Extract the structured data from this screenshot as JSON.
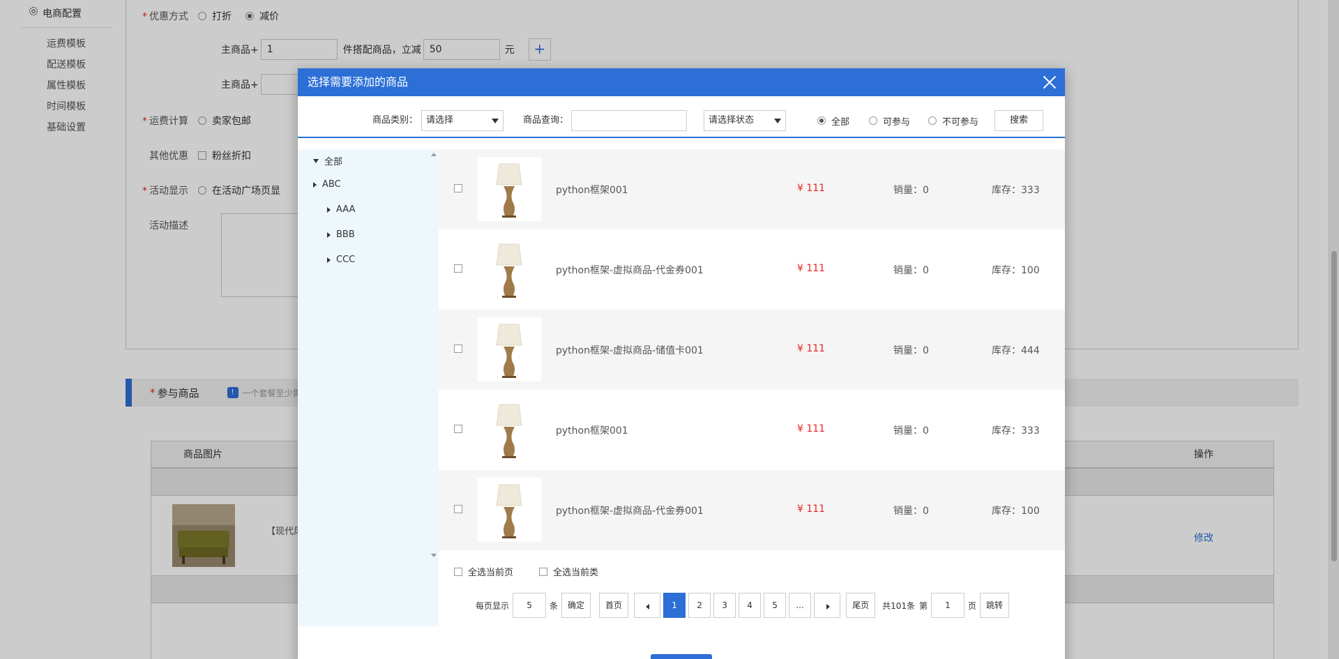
{
  "sidebar": {
    "head_label": "电商配置",
    "items": [
      "运费模板",
      "配送模板",
      "属性模板",
      "时间模板",
      "基础设置"
    ]
  },
  "form": {
    "discount_label": "优惠方式",
    "discount_opt_rebate": "打折",
    "discount_opt_reduce": "减价",
    "row1_prefix": "主商品+",
    "row1_qty": "1",
    "row1_middle": "件搭配商品，立减",
    "row1_amount": "50",
    "row1_unit": "元",
    "plus": "+",
    "row2_prefix": "主商品+",
    "shipping_label": "运费计算",
    "shipping_opt": "卖家包邮",
    "other_label": "其他优惠",
    "other_opt": "粉丝折扣",
    "display_label": "活动显示",
    "display_opt": "在活动广场页显",
    "desc_label": "活动描述"
  },
  "section": {
    "title": "参与商品",
    "info_icon_text": "!",
    "tip": "一个套餐至少需"
  },
  "product_table": {
    "col_image": "商品图片",
    "col_action": "操作",
    "row_name": "【现代风",
    "edit": "修改"
  },
  "modal": {
    "title": "选择需要添加的商品",
    "search": {
      "category_label": "商品类别：",
      "category_value": "请选择",
      "query_label": "商品查询：",
      "query_value": "",
      "status_value": "请选择状态",
      "radio_all": "全部",
      "radio_can": "可参与",
      "radio_cannot": "不可参与",
      "search_button": "搜索"
    },
    "tree": {
      "root": "全部",
      "abc": "ABC",
      "aaa": "AAA",
      "bbb": "BBB",
      "ccc": "CCC"
    },
    "goods": [
      {
        "name": "python框架001",
        "price": "¥ 111",
        "sales": "销量：0",
        "stock": "库存：333"
      },
      {
        "name": "python框架-虚拟商品-代金券001",
        "price": "¥ 111",
        "sales": "销量：0",
        "stock": "库存：100"
      },
      {
        "name": "python框架-虚拟商品-储值卡001",
        "price": "¥ 111",
        "sales": "销量：0",
        "stock": "库存：444"
      },
      {
        "name": "python框架001",
        "price": "¥ 111",
        "sales": "销量：0",
        "stock": "库存：333"
      },
      {
        "name": "python框架-虚拟商品-代金券001",
        "price": "¥ 111",
        "sales": "销量：0",
        "stock": "库存：100"
      }
    ],
    "select_page": "全选当前页",
    "select_category": "全选当前类",
    "pager": {
      "per_page_label": "每页显示",
      "per_page_value": "5",
      "per_page_unit": "条",
      "confirm": "确定",
      "first": "首页",
      "pages": [
        "1",
        "2",
        "3",
        "4",
        "5",
        "..."
      ],
      "current": "1",
      "last": "尾页",
      "total": "共101条",
      "goto_prefix": "第",
      "goto_value": "1",
      "goto_suffix": "页",
      "goto_button": "跳转"
    }
  },
  "colors": {
    "accent": "#2c6fd6",
    "price": "#ee2222",
    "tree_bg": "#eef8fc"
  }
}
